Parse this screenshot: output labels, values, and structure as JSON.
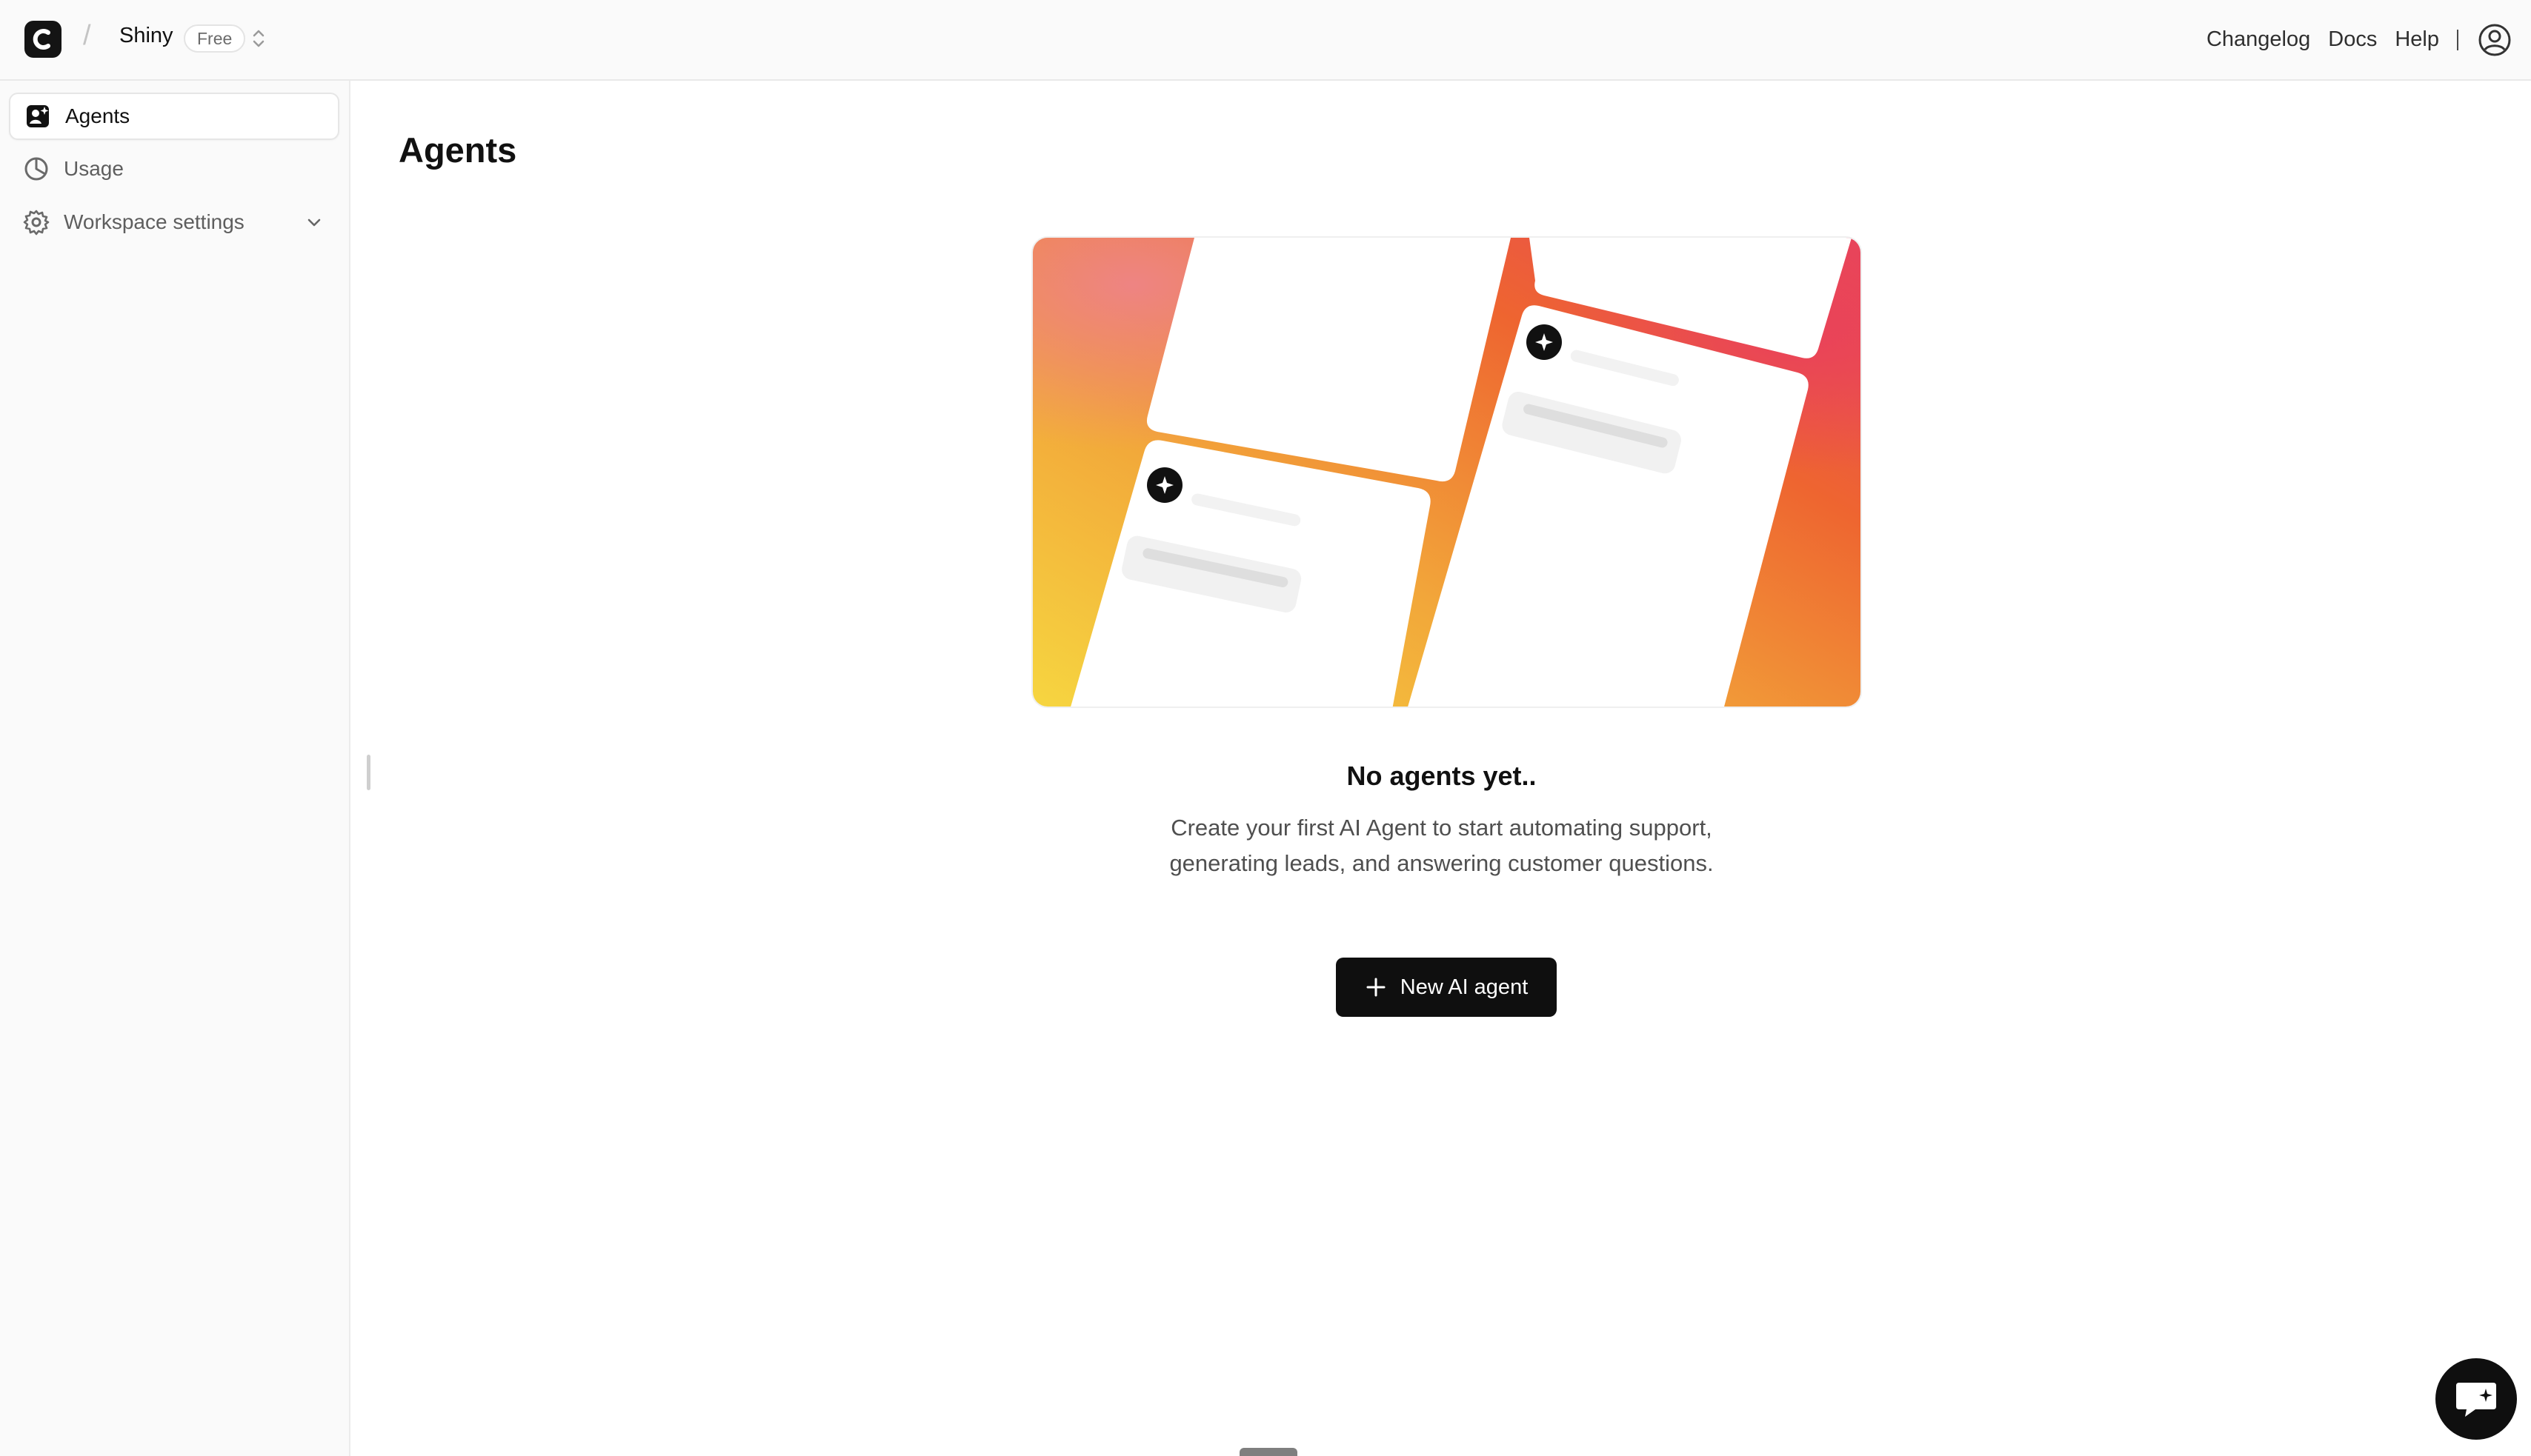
{
  "app": {
    "workspace_name": "Shiny",
    "plan_badge": "Free",
    "breadcrumb_separator": "/"
  },
  "header": {
    "links": [
      "Changelog",
      "Docs",
      "Help"
    ],
    "divider": "|"
  },
  "sidebar": {
    "items": [
      {
        "label": "Agents",
        "icon": "agent-icon",
        "active": true
      },
      {
        "label": "Usage",
        "icon": "pie-chart-icon",
        "active": false
      },
      {
        "label": "Workspace settings",
        "icon": "gear-icon",
        "active": false,
        "expandable": true
      }
    ]
  },
  "main": {
    "title": "Agents",
    "empty_state": {
      "title": "No agents yet..",
      "description_line1": "Create your first AI Agent to start automating support,",
      "description_line2": "generating leads, and answering customer questions.",
      "button_label": "New AI agent"
    }
  },
  "colors": {
    "accent_dark": "#0f0f0f",
    "gradient_pink": "#ec5a6a",
    "gradient_orange": "#ee6a30",
    "gradient_yellow": "#f6cf3e"
  }
}
